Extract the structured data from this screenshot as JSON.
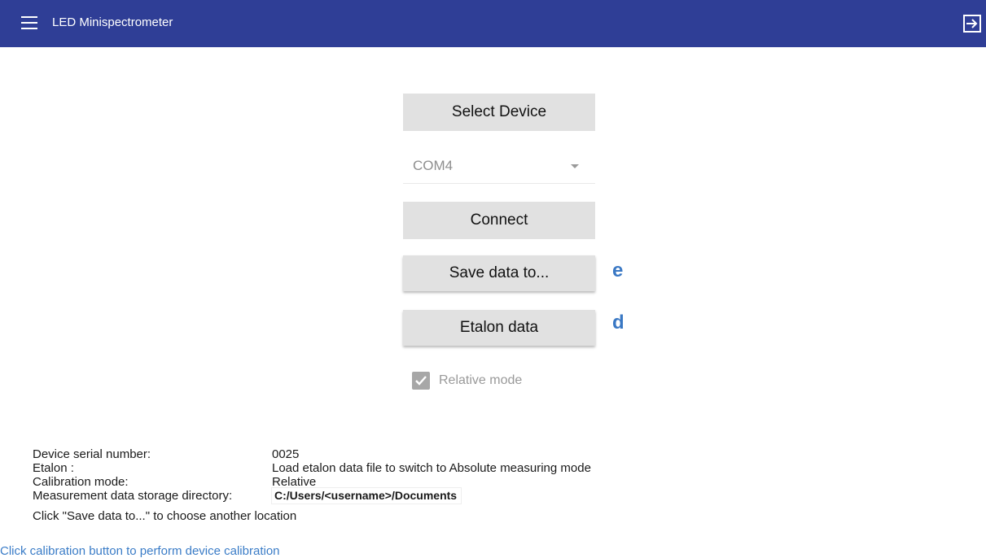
{
  "app": {
    "title": "LED Minispectrometer"
  },
  "buttons": {
    "select_device": "Select Device",
    "connect": "Connect",
    "save_data": "Save data to...",
    "etalon_data": "Etalon data"
  },
  "port_select": {
    "value": "COM4"
  },
  "annotations": {
    "save": "e",
    "etalon": "d"
  },
  "relative_mode": {
    "label": "Relative mode",
    "checked": true
  },
  "info": {
    "serial_label": "Device serial number:",
    "serial_value": "0025",
    "etalon_label": "Etalon :",
    "etalon_value": "Load etalon data file to switch to Absolute measuring mode",
    "calibration_label": "Calibration mode:",
    "calibration_value": "Relative",
    "storage_label": "Measurement data storage directory:",
    "storage_value": "C:/Users/<username>/Documents",
    "hint": "Click \"Save data to...\" to choose another location",
    "calibration_link": "Click calibration button to perform device calibration"
  },
  "colors": {
    "titlebar": "#2f3e96",
    "annotation": "#3a78c4",
    "link": "#3a7cc7"
  },
  "icons": [
    "menu-icon",
    "exit-icon",
    "chevron-down-icon",
    "checkmark-icon"
  ]
}
